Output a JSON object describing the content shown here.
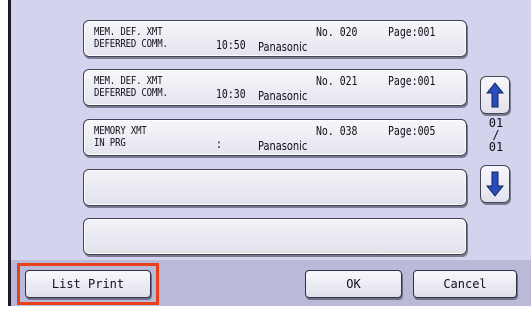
{
  "jobs": [
    {
      "line1": "MEM. DEF. XMT",
      "line2": "DEFERRED COMM.",
      "time": "10:50",
      "number": "No. 020",
      "page": "Page:001",
      "station": "Panasonic"
    },
    {
      "line1": "MEM. DEF. XMT",
      "line2": "DEFERRED COMM.",
      "time": "10:30",
      "number": "No. 021",
      "page": "Page:001",
      "station": "Panasonic"
    },
    {
      "line1": "MEMORY XMT",
      "line2": "IN PRG",
      "time": ":",
      "number": "No. 038",
      "page": "Page:005",
      "station": "Panasonic"
    }
  ],
  "pager": {
    "current": "01",
    "separator": "/",
    "total": "01"
  },
  "buttons": {
    "list_print": "List Print",
    "ok": "OK",
    "cancel": "Cancel"
  },
  "colors": {
    "panel_bg": "#d3d3ee",
    "arrow_blue": "#2a4dbe",
    "highlight": "#e8401c"
  },
  "icons": {
    "scroll_up": "arrow-up-icon",
    "scroll_down": "arrow-down-icon"
  }
}
